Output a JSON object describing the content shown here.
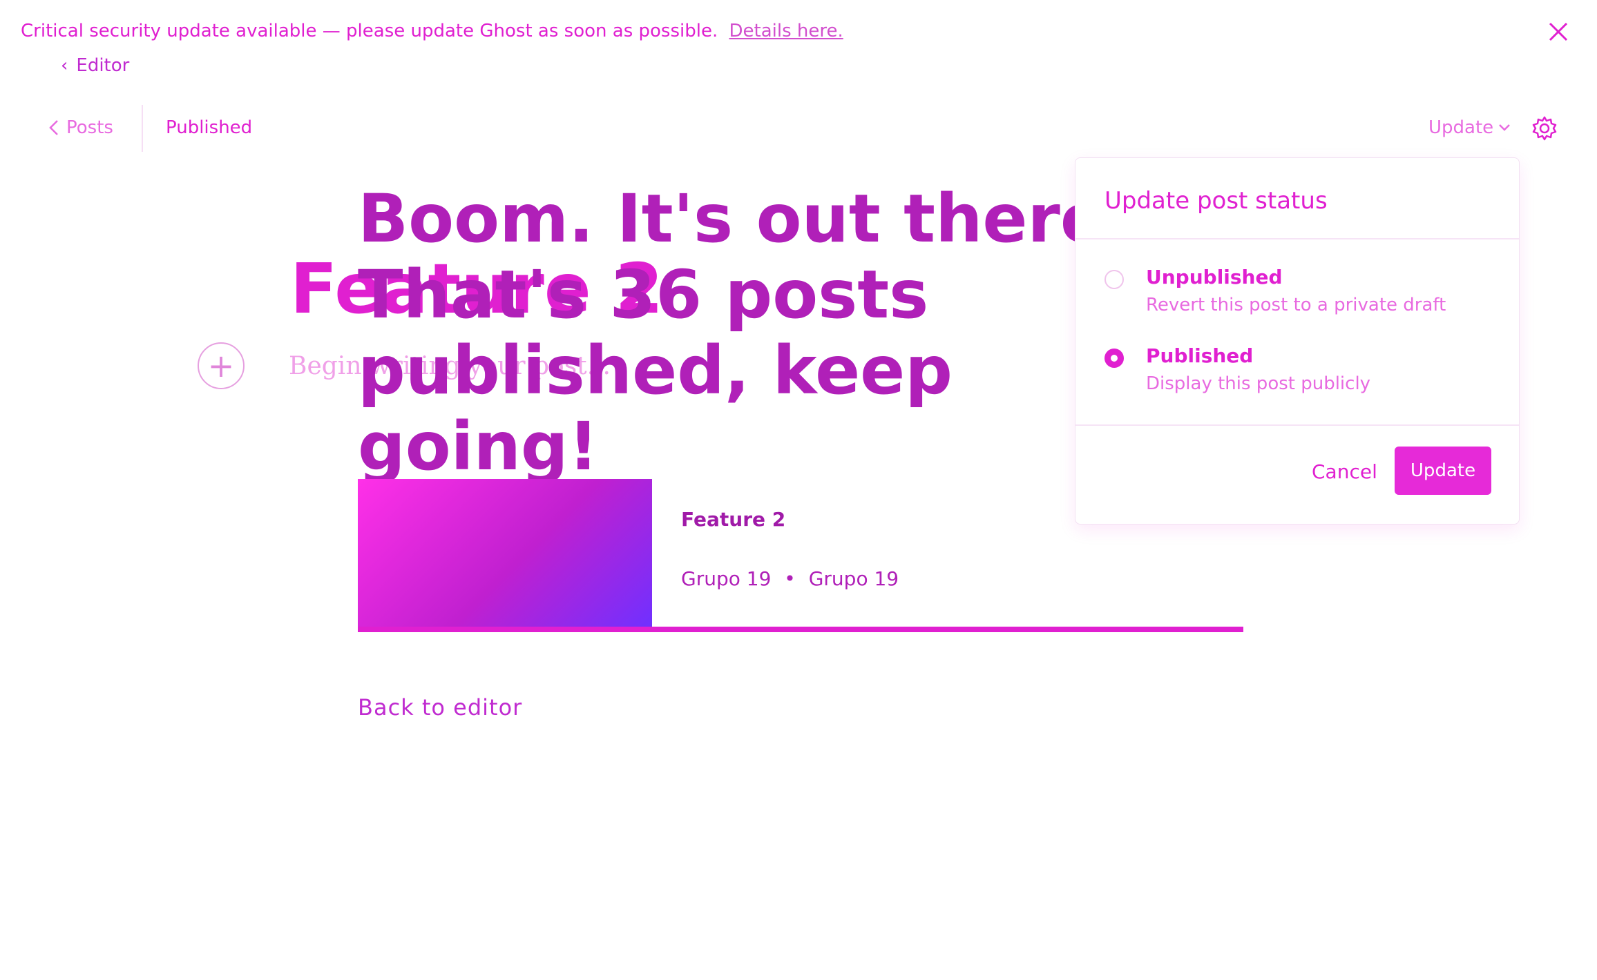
{
  "banner": {
    "message": "Critical security update available — please update Ghost as soon as possible.",
    "link": "Details here."
  },
  "breadcrumb": {
    "editor": "Editor"
  },
  "header": {
    "posts_link": "Posts",
    "status": "Published",
    "update_toggle": "Update"
  },
  "editor": {
    "post_title": "Feature 2",
    "body_placeholder": "Begin writing your post..."
  },
  "celebration": {
    "headline": "Boom. It's out there. That's 36 posts published, keep going!",
    "card": {
      "title": "Feature 2",
      "author": "Grupo 19",
      "separator": "•",
      "publisher": "Grupo 19"
    },
    "back_link": "Back to editor"
  },
  "status_popover": {
    "header": "Update post status",
    "options": [
      {
        "label": "Unpublished",
        "description": "Revert this post to a private draft",
        "selected": false
      },
      {
        "label": "Published",
        "description": "Display this post publicly",
        "selected": true
      }
    ],
    "cancel": "Cancel",
    "confirm": "Update"
  },
  "colors": {
    "accent": "#e020d0",
    "headline": "#b020b8"
  }
}
